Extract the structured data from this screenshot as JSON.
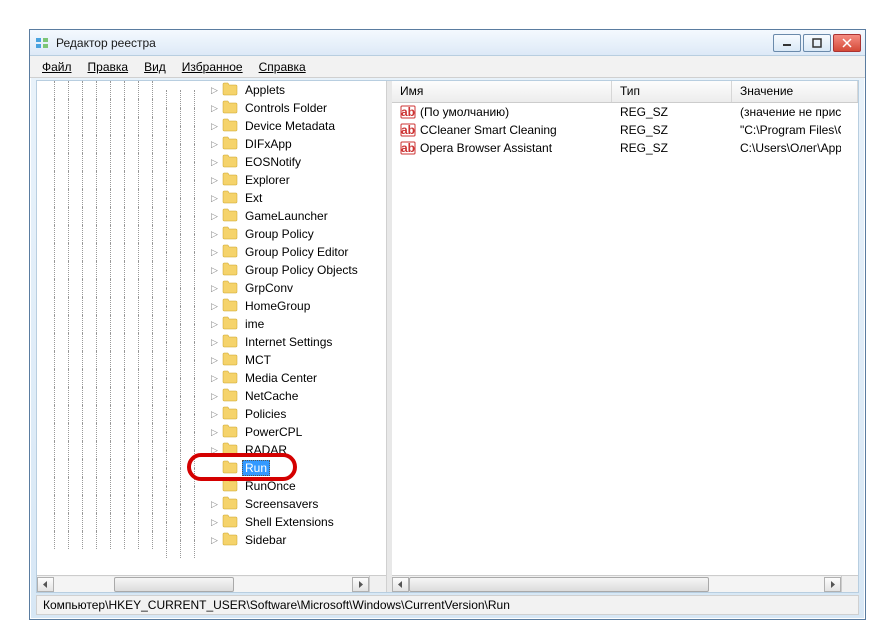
{
  "window": {
    "title": "Редактор реестра"
  },
  "menu": {
    "file": "Файл",
    "edit": "Правка",
    "view": "Вид",
    "favorites": "Избранное",
    "help": "Справка"
  },
  "tree": {
    "items": [
      {
        "label": "Applets"
      },
      {
        "label": "Controls Folder"
      },
      {
        "label": "Device Metadata"
      },
      {
        "label": "DIFxApp"
      },
      {
        "label": "EOSNotify"
      },
      {
        "label": "Explorer"
      },
      {
        "label": "Ext"
      },
      {
        "label": "GameLauncher"
      },
      {
        "label": "Group Policy"
      },
      {
        "label": "Group Policy Editor"
      },
      {
        "label": "Group Policy Objects"
      },
      {
        "label": "GrpConv"
      },
      {
        "label": "HomeGroup"
      },
      {
        "label": "ime"
      },
      {
        "label": "Internet Settings"
      },
      {
        "label": "MCT"
      },
      {
        "label": "Media Center"
      },
      {
        "label": "NetCache"
      },
      {
        "label": "Policies"
      },
      {
        "label": "PowerCPL"
      },
      {
        "label": "RADAR"
      },
      {
        "label": "Run",
        "selected": true,
        "highlighted": true,
        "leaf": true
      },
      {
        "label": "RunOnce",
        "leaf": true
      },
      {
        "label": "Screensavers"
      },
      {
        "label": "Shell Extensions"
      },
      {
        "label": "Sidebar"
      }
    ]
  },
  "list": {
    "columns": {
      "name": "Имя",
      "type": "Тип",
      "value": "Значение"
    },
    "widths": {
      "name": 220,
      "type": 120,
      "value": 200
    },
    "rows": [
      {
        "name": "(По умолчанию)",
        "type": "REG_SZ",
        "value": "(значение не присвоено)"
      },
      {
        "name": "CCleaner Smart Cleaning",
        "type": "REG_SZ",
        "value": "\"C:\\Program Files\\CCleaner"
      },
      {
        "name": "Opera Browser Assistant",
        "type": "REG_SZ",
        "value": "C:\\Users\\Олег\\AppData\\Lo"
      }
    ]
  },
  "statusbar": {
    "path": "Компьютер\\HKEY_CURRENT_USER\\Software\\Microsoft\\Windows\\CurrentVersion\\Run"
  }
}
